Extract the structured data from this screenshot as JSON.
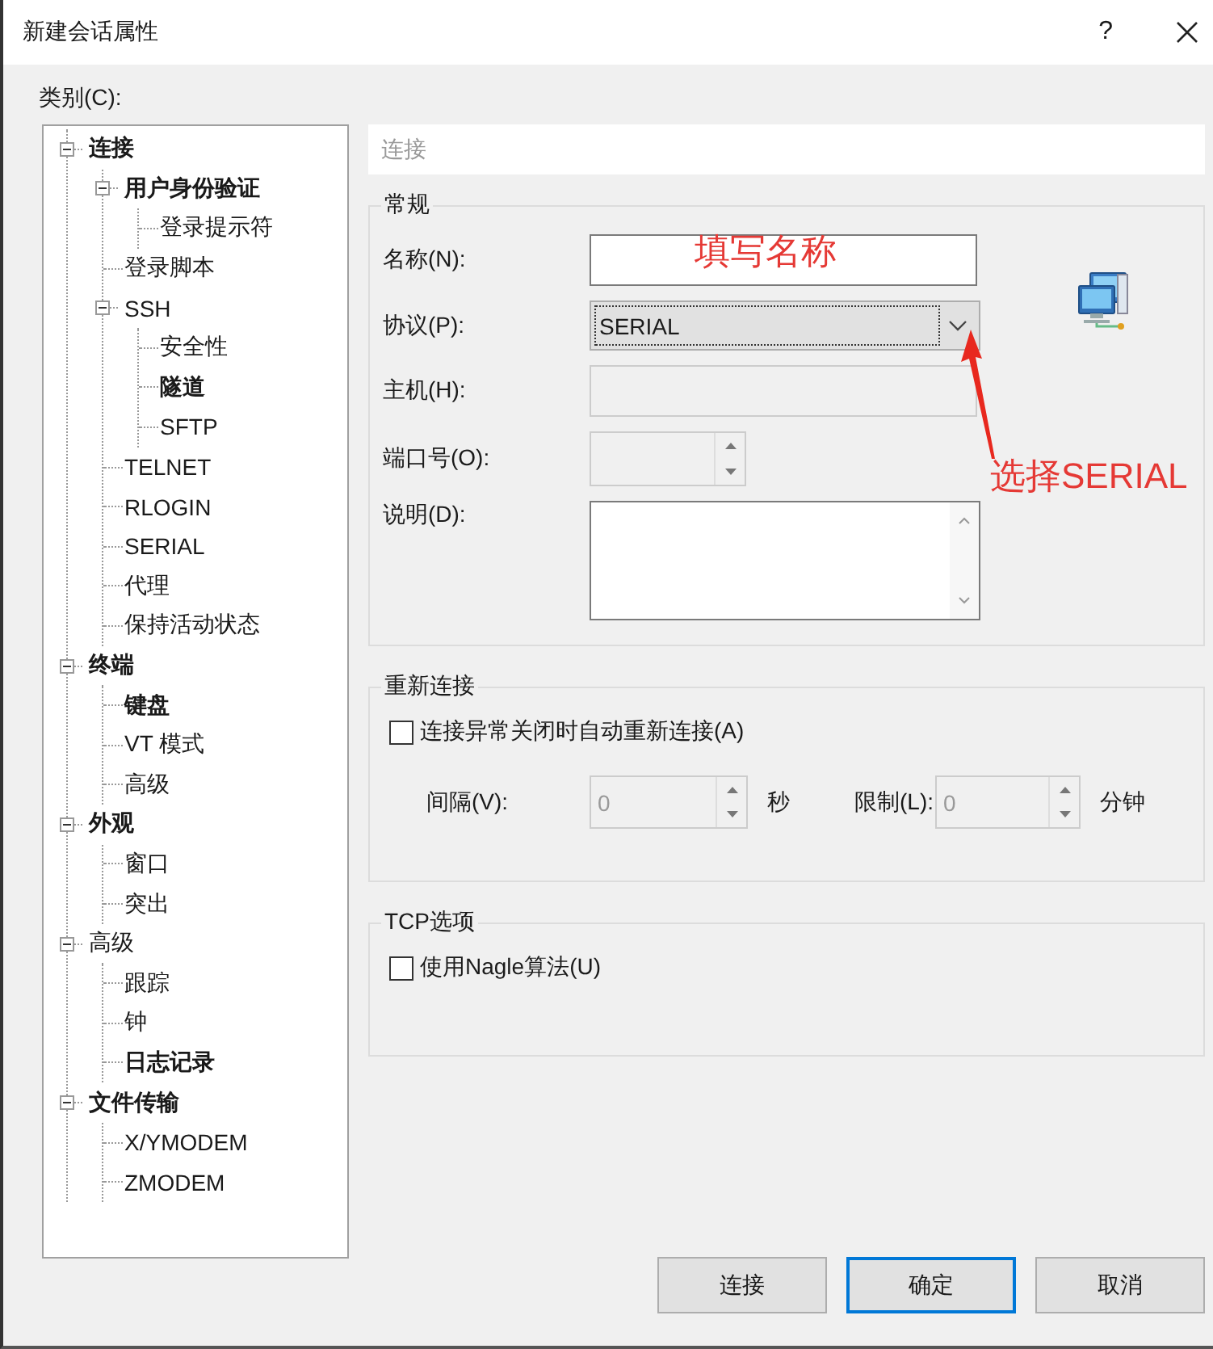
{
  "window": {
    "title": "新建会话属性",
    "help": "?"
  },
  "category_label": "类别(C):",
  "tree": [
    {
      "label": "连接",
      "bold": true,
      "expanded": true,
      "children": [
        {
          "label": "用户身份验证",
          "bold": true,
          "expanded": true,
          "children": [
            {
              "label": "登录提示符",
              "bold": false
            }
          ]
        },
        {
          "label": "登录脚本",
          "bold": false
        },
        {
          "label": "SSH",
          "bold": false,
          "expanded": true,
          "children": [
            {
              "label": "安全性",
              "bold": false
            },
            {
              "label": "隧道",
              "bold": true
            },
            {
              "label": "SFTP",
              "bold": false
            }
          ]
        },
        {
          "label": "TELNET",
          "bold": false
        },
        {
          "label": "RLOGIN",
          "bold": false
        },
        {
          "label": "SERIAL",
          "bold": false
        },
        {
          "label": "代理",
          "bold": false
        },
        {
          "label": "保持活动状态",
          "bold": false
        }
      ]
    },
    {
      "label": "终端",
      "bold": true,
      "expanded": true,
      "children": [
        {
          "label": "键盘",
          "bold": true
        },
        {
          "label": "VT 模式",
          "bold": false
        },
        {
          "label": "高级",
          "bold": false
        }
      ]
    },
    {
      "label": "外观",
      "bold": true,
      "expanded": true,
      "children": [
        {
          "label": "窗口",
          "bold": false
        },
        {
          "label": "突出",
          "bold": false
        }
      ]
    },
    {
      "label": "高级",
      "bold": false,
      "expanded": true,
      "children": [
        {
          "label": "跟踪",
          "bold": false
        },
        {
          "label": "钟",
          "bold": false
        },
        {
          "label": "日志记录",
          "bold": true
        }
      ]
    },
    {
      "label": "文件传输",
      "bold": true,
      "expanded": true,
      "children": [
        {
          "label": "X/YMODEM",
          "bold": false
        },
        {
          "label": "ZMODEM",
          "bold": false
        }
      ]
    }
  ],
  "panel_header": "连接",
  "general": {
    "title": "常规",
    "fields": [
      {
        "kind": "text",
        "label": "名称(N):",
        "disabled": false,
        "focused": false
      },
      {
        "kind": "combo",
        "label": "协议(P):",
        "value": "SERIAL",
        "disabled": false,
        "focused": true
      },
      {
        "kind": "text",
        "label": "主机(H):",
        "disabled": true,
        "focused": false
      },
      {
        "kind": "spin",
        "label": "端口号(O):",
        "disabled": true,
        "focused": false
      },
      {
        "kind": "textarea",
        "label": "说明(D):",
        "disabled": false,
        "focused": false
      }
    ]
  },
  "reconnect": {
    "title": "重新连接",
    "checkbox": {
      "label": "连接异常关闭时自动重新连接(A)",
      "checked": false
    },
    "spinners": [
      {
        "label": "间隔(V):",
        "value": "0",
        "unit": "秒",
        "disabled": true
      },
      {
        "label": "限制(L):",
        "value": "0",
        "unit": "分钟",
        "disabled": true
      }
    ]
  },
  "tcp": {
    "title": "TCP选项",
    "checkbox": {
      "label": "使用Nagle算法(U)",
      "checked": false
    }
  },
  "annotations": [
    {
      "kind": "note",
      "text": "填写名称"
    },
    {
      "kind": "arrow_note",
      "text": "选择SERIAL"
    }
  ],
  "buttons": [
    {
      "label": "连接",
      "default": false
    },
    {
      "label": "确定",
      "default": true
    },
    {
      "label": "取消",
      "default": false
    }
  ]
}
